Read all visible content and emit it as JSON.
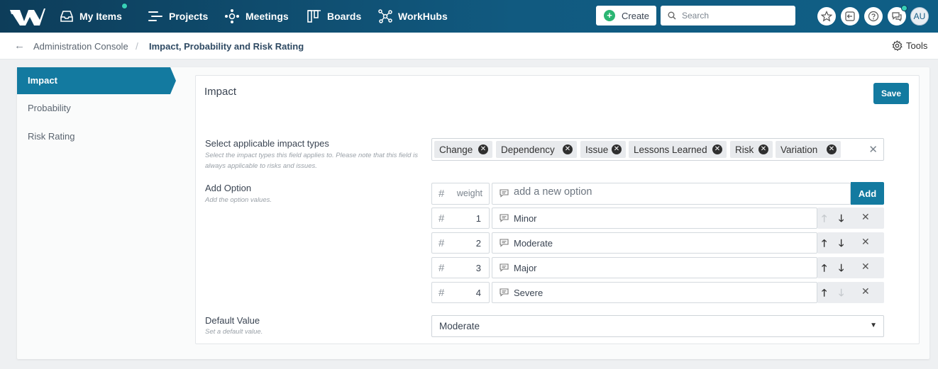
{
  "nav": {
    "items": [
      {
        "label": "My Items",
        "icon": "inbox-icon"
      },
      {
        "label": "Projects",
        "icon": "projects-icon"
      },
      {
        "label": "Meetings",
        "icon": "meetings-icon"
      },
      {
        "label": "Boards",
        "icon": "boards-icon"
      },
      {
        "label": "WorkHubs",
        "icon": "workhubs-icon"
      }
    ],
    "create_label": "Create",
    "search_placeholder": "Search",
    "avatar_initials": "AU"
  },
  "breadcrumb": {
    "parent": "Administration Console",
    "current": "Impact, Probability and Risk Rating",
    "tools_label": "Tools"
  },
  "sidebar": {
    "items": [
      {
        "label": "Impact",
        "active": true
      },
      {
        "label": "Probability",
        "active": false
      },
      {
        "label": "Risk Rating",
        "active": false
      }
    ]
  },
  "panel": {
    "title": "Impact",
    "save_label": "Save",
    "impact_types": {
      "label": "Select applicable impact types",
      "help": "Select the impact types this field applies to. Please note that this field is always applicable to risks and issues.",
      "tags": [
        "Change",
        "Dependency",
        "Issue",
        "Lessons Learned",
        "Risk",
        "Variation"
      ]
    },
    "add_option": {
      "label": "Add Option",
      "help": "Add the option values.",
      "weight_placeholder": "weight",
      "option_placeholder": "add a new option",
      "add_label": "Add"
    },
    "options": [
      {
        "weight": "1",
        "label": "Minor",
        "can_up": false,
        "can_down": true
      },
      {
        "weight": "2",
        "label": "Moderate",
        "can_up": true,
        "can_down": true
      },
      {
        "weight": "3",
        "label": "Major",
        "can_up": true,
        "can_down": true
      },
      {
        "weight": "4",
        "label": "Severe",
        "can_up": true,
        "can_down": false
      }
    ],
    "default_value": {
      "label": "Default Value",
      "help": "Set a default value.",
      "selected": "Moderate"
    }
  },
  "colors": {
    "accent": "#137aa0",
    "nav_dark": "#0d3d5a",
    "create_green": "#2bb673"
  }
}
